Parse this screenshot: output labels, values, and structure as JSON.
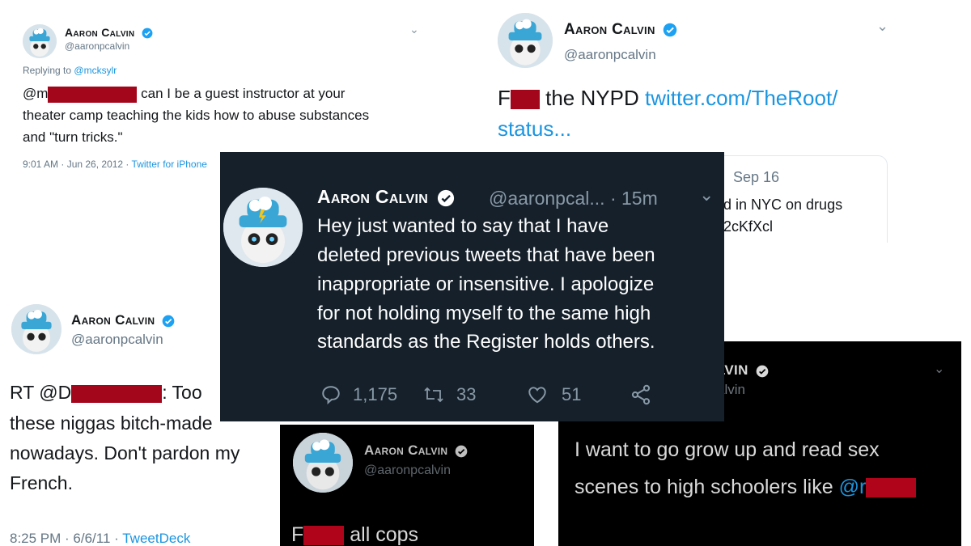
{
  "colors": {
    "link": "#1b95e0",
    "verified": "#1da1f2",
    "redaction": "#a3051b",
    "dark_bg": "#15202b",
    "black_bg": "#000000"
  },
  "author": {
    "name": "Aaron Calvin",
    "handle": "@aaronpcalvin",
    "handle_truncated": "@aaronpcal...",
    "avatar_icon": "cat-in-hat-avatar-icon",
    "verified_icon": "verified-badge-icon"
  },
  "tweet1": {
    "replying_label": "Replying to",
    "replying_to": "@mcksylr",
    "line1_prefix": "@m",
    "line1_suffix": "can I be a guest instructor at your",
    "line2": "theater camp teaching the kids how to abuse substances",
    "line3": "and \"turn tricks.\"",
    "timestamp": "9:01 AM · Jun 26, 2012 ·",
    "source": "Twitter for iPhone"
  },
  "tweet2": {
    "text_prefix": "F",
    "text_middle": "the NYPD",
    "link": "twitter.com/TheRoot/",
    "link2": "status...",
    "quoted_date": "Sep 16",
    "quoted_line1": "d in NYC on drugs",
    "quoted_line2": "2cKfXcl"
  },
  "tweet3": {
    "prefix": "RT @D",
    "after_redaction": ": Too",
    "line2": "these niggas bitch-made",
    "line3": "nowadays. Don't pardon my",
    "line4": "French.",
    "timestamp": "8:25 PM · 6/6/11 ·",
    "source": "TweetDeck"
  },
  "tweet4": {
    "text_prefix": "F",
    "text_suffix": "all cops"
  },
  "tweet5": {
    "name_partial": "LVIN",
    "handle_partial": "alvin",
    "line1": "I want to go grow up and read sex",
    "line2_prefix": "scenes to high schoolers like",
    "mention_partial": "@r"
  },
  "apology": {
    "time": "· 15m",
    "line1": "Hey just wanted to say that I have",
    "line2": "deleted previous tweets that have been",
    "line3": "inappropriate or insensitive. I apologize",
    "line4": "for not holding myself to the same high",
    "line5": "standards as the Register holds others.",
    "replies": "1,175",
    "retweets": "33",
    "likes": "51",
    "icons": [
      "reply-icon",
      "retweet-icon",
      "like-icon",
      "share-icon"
    ]
  }
}
